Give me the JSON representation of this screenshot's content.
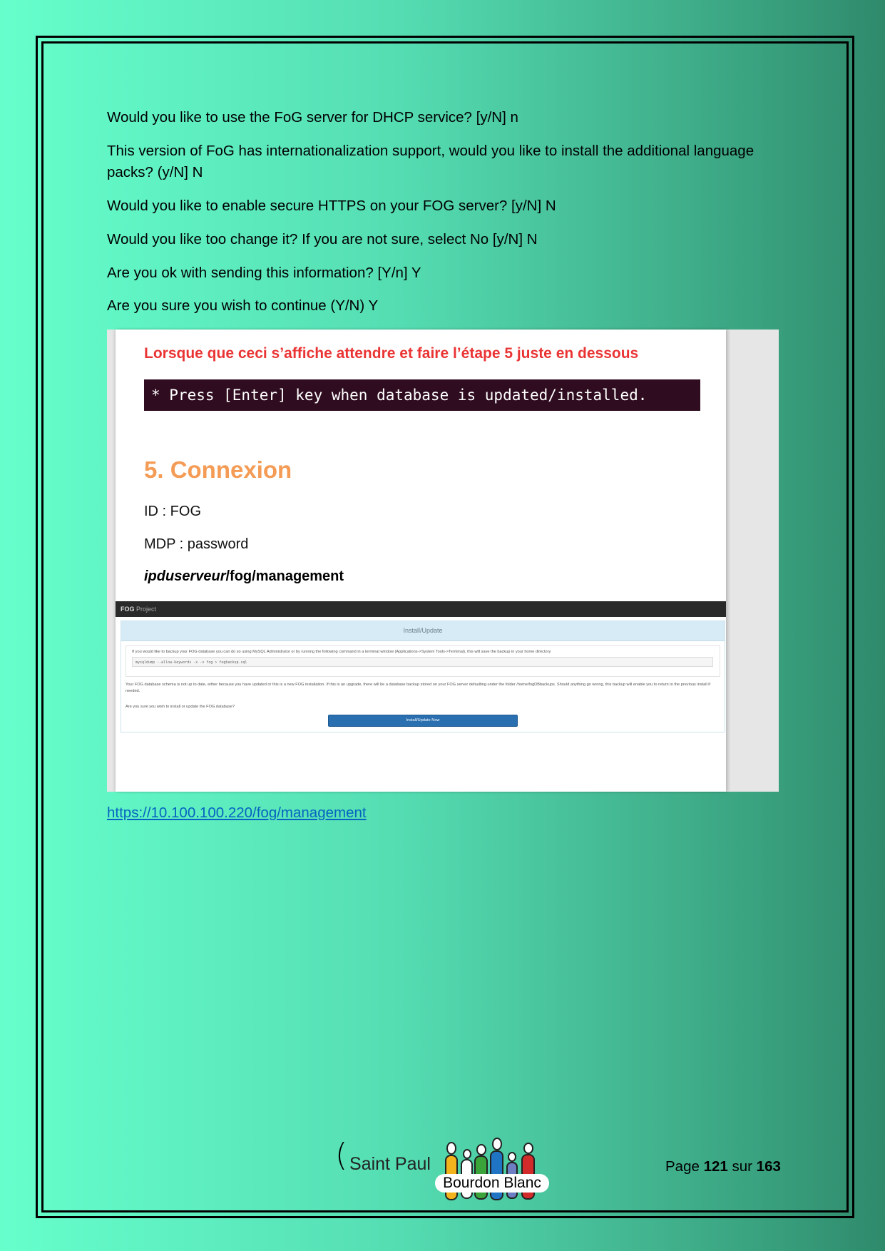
{
  "paragraphs": [
    "Would you like to use the FoG server for DHCP service? [y/N] n",
    "This version of FoG has internationalization support, would you like to install the additional language packs? (y/N] N",
    "Would you like to enable secure HTTPS on your FOG server? [y/N] N",
    "Would you like too change it? If you are not sure, select No [y/N] N",
    "Are you ok with sending this information? [Y/n] Y",
    "Are you sure you wish to continue (Y/N) Y"
  ],
  "screenshot": {
    "note": "Lorsque que ceci s’affiche attendre et faire l’étape 5 juste en dessous",
    "terminal": " * Press [Enter] key when database is updated/installed.",
    "section_title": "5. Connexion",
    "id_line": "ID : FOG",
    "mdp_line": "MDP : password",
    "url_italic": "ipduserveur",
    "url_rest": "/fog/management",
    "fog": {
      "brand": "FOG",
      "brand_rest": " Project",
      "panel_title": "Install/Update",
      "backup_text": "If you would like to backup your FOG database you can do so using MySQL Administrator or by running the following command in a terminal window (Applications->System Tools->Terminal), this will save the backup in your home directory",
      "backup_cmd": "mysqldump --allow-keywords -x -v fog > fogbackup.sql",
      "schema_text": "Your FOG database schema is not up to date, either because you have updated or this is a new FOG installation. If this is an upgrade, there will be a database backup stored on your FOG server defaulting under the folder /home/fogDBbackups. Should anything go wrong, this backup will enable you to return to the previous install if needed.",
      "question": "Are you sure you wish to install or update the FOG database?",
      "button": "Install/Update Now"
    }
  },
  "link": "https://10.100.100.220/fog/management",
  "footer": {
    "logo_paren": "(",
    "logo_left": "Saint Paul",
    "logo_right": "Bourdon Blanc",
    "page_prefix": "Page ",
    "page_current": "121",
    "page_mid": " sur ",
    "page_total": "163"
  }
}
